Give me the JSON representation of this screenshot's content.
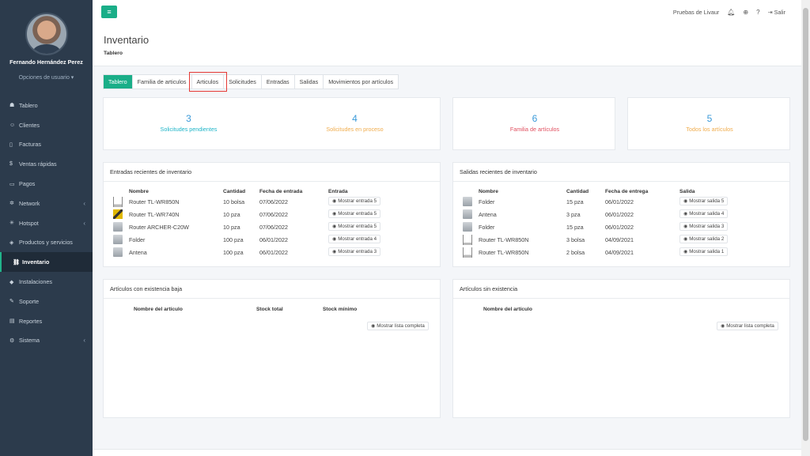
{
  "user": {
    "name": "Fernando Hernández Perez",
    "options": "Opciones de usuario ▾"
  },
  "nav": [
    {
      "icon": "☗",
      "label": "Tablero",
      "chev": ""
    },
    {
      "icon": "☺",
      "label": "Clientes",
      "chev": ""
    },
    {
      "icon": "▯",
      "label": "Facturas",
      "chev": ""
    },
    {
      "icon": "$",
      "label": "Ventas rápidas",
      "chev": ""
    },
    {
      "icon": "▭",
      "label": "Pagos",
      "chev": ""
    },
    {
      "icon": "✲",
      "label": "Network",
      "chev": "‹"
    },
    {
      "icon": "✳",
      "label": "Hotspot",
      "chev": "‹"
    },
    {
      "icon": "◈",
      "label": "Productos y servicios",
      "chev": ""
    },
    {
      "icon": "⛓",
      "label": "Inventario",
      "chev": ""
    },
    {
      "icon": "◆",
      "label": "Instalaciones",
      "chev": ""
    },
    {
      "icon": "✎",
      "label": "Soporte",
      "chev": ""
    },
    {
      "icon": "▤",
      "label": "Reportes",
      "chev": ""
    },
    {
      "icon": "⚙",
      "label": "Sistema",
      "chev": "‹"
    }
  ],
  "header": {
    "menu_icon": "≡",
    "company": "Pruebas de Livaur",
    "logout": "Salir"
  },
  "page": {
    "title": "Inventario",
    "subtitle": "Tablero"
  },
  "tabs": [
    "Tablero",
    "Familia de articulos",
    "Articulos",
    "Solicitudes",
    "Entradas",
    "Salidas",
    "Movimientos por artículos"
  ],
  "stats": {
    "pending": {
      "num": "3",
      "label": "Solicitudes pendientes"
    },
    "process": {
      "num": "4",
      "label": "Solicitudes en proceso"
    },
    "families": {
      "num": "6",
      "label": "Familia de artículos"
    },
    "all": {
      "num": "5",
      "label": "Todos los artículos"
    }
  },
  "entries": {
    "title": "Entradas recientes de inventario",
    "headers": [
      "Nombre",
      "Cantidad",
      "Fecha de entrada",
      "Entrada"
    ],
    "rows": [
      {
        "name": "Router TL-WR850N",
        "qty": "10 bolsa",
        "date": "07/06/2022",
        "btn": "Mostrar entrada 5",
        "thumb": "router"
      },
      {
        "name": "Router TL-WR740N",
        "qty": "10 pza",
        "date": "07/06/2022",
        "btn": "Mostrar entrada 5",
        "thumb": "gold"
      },
      {
        "name": "Router ARCHER-C20W",
        "qty": "10 pza",
        "date": "07/06/2022",
        "btn": "Mostrar entrada 5",
        "thumb": "doc"
      },
      {
        "name": "Folder",
        "qty": "100 pza",
        "date": "06/01/2022",
        "btn": "Mostrar entrada 4",
        "thumb": "doc"
      },
      {
        "name": "Antena",
        "qty": "100 pza",
        "date": "06/01/2022",
        "btn": "Mostrar entrada 3",
        "thumb": "doc"
      }
    ]
  },
  "exits": {
    "title": "Salidas recientes de inventario",
    "headers": [
      "Nombre",
      "Cantidad",
      "Fecha de entrega",
      "Salida"
    ],
    "rows": [
      {
        "name": "Folder",
        "qty": "15 pza",
        "date": "06/01/2022",
        "btn": "Mostrar salida 5",
        "thumb": "doc"
      },
      {
        "name": "Antena",
        "qty": "3 pza",
        "date": "06/01/2022",
        "btn": "Mostrar salida 4",
        "thumb": "doc"
      },
      {
        "name": "Folder",
        "qty": "15 pza",
        "date": "06/01/2022",
        "btn": "Mostrar salida 3",
        "thumb": "doc"
      },
      {
        "name": "Router TL-WR850N",
        "qty": "3 bolsa",
        "date": "04/09/2021",
        "btn": "Mostrar salida 2",
        "thumb": "router"
      },
      {
        "name": "Router TL-WR850N",
        "qty": "2 bolsa",
        "date": "04/09/2021",
        "btn": "Mostrar salida 1",
        "thumb": "router"
      }
    ]
  },
  "low_stock": {
    "title": "Artículos con existencia baja",
    "headers": [
      "Nombre del artículo",
      "Stock total",
      "Stock mínimo"
    ],
    "button": "Mostrar lista completa"
  },
  "no_stock": {
    "title": "Artículos sin existencia",
    "headers": [
      "Nombre del artículo"
    ],
    "button": "Mostrar lista completa"
  },
  "colors": {
    "accent": "#1aae88",
    "blue": "#3a9ad9",
    "orange": "#f0ad4e",
    "red": "#e04f5f",
    "cyan": "#1fb5c8"
  }
}
